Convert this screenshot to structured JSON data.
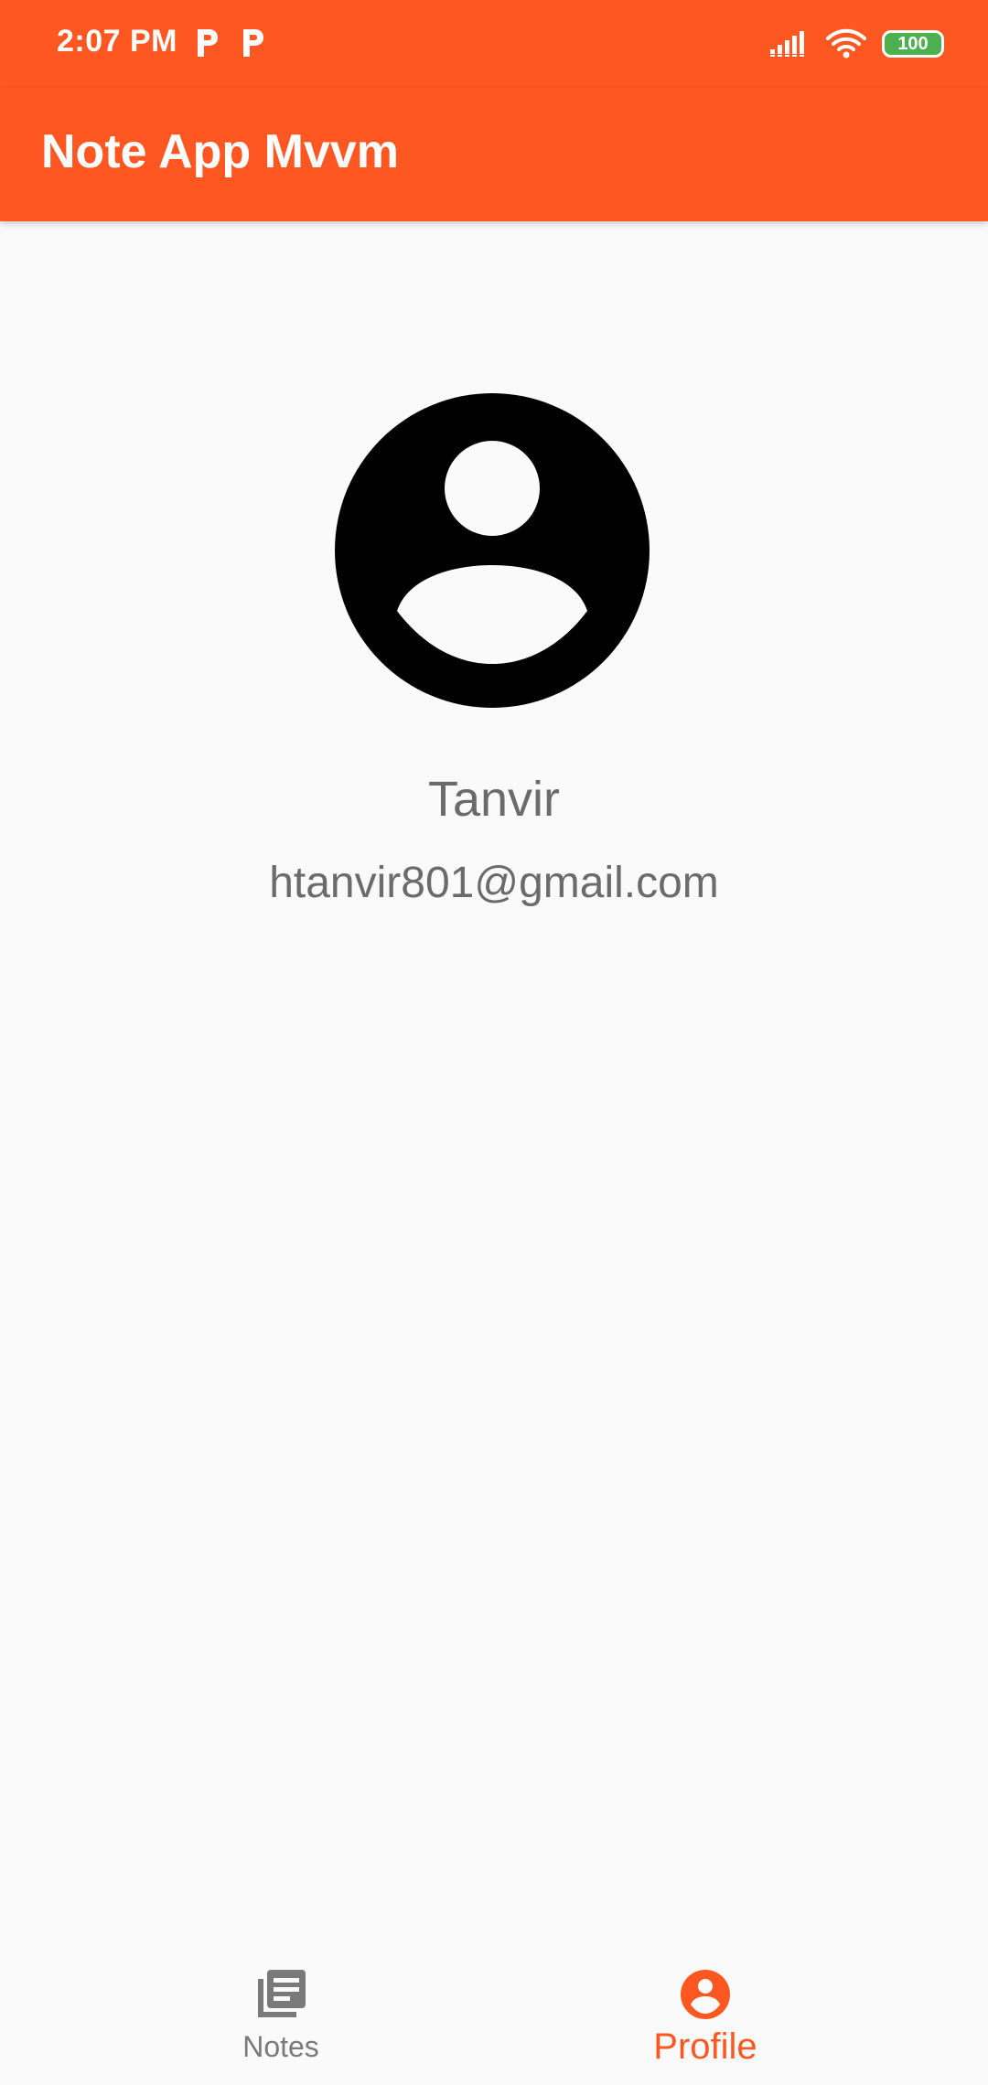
{
  "status_bar": {
    "time": "2:07 PM",
    "battery": "100",
    "icons": [
      "p-notification-icon",
      "p-notification-icon",
      "signal-icon",
      "wifi-icon",
      "battery-icon"
    ]
  },
  "app_bar": {
    "title": "Note App Mvvm",
    "color": "#ff5722"
  },
  "profile": {
    "avatar_icon": "account-circle-icon",
    "name": "Tanvir",
    "email": "htanvir801@gmail.com"
  },
  "bottom_nav": {
    "items": [
      {
        "label": "Notes",
        "icon": "notes-icon",
        "selected": false
      },
      {
        "label": "Profile",
        "icon": "account-icon",
        "selected": true
      }
    ],
    "active_color": "#ff5722",
    "inactive_color": "#7a7a7a"
  }
}
